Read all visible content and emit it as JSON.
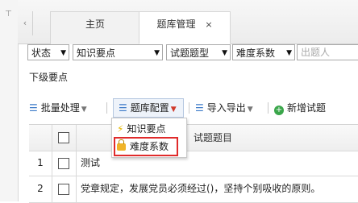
{
  "tabs": [
    {
      "label": "主页"
    },
    {
      "label": "题库管理",
      "close": "×"
    }
  ],
  "tab_prev_arrow": "‹",
  "pin": "⊤",
  "filters": {
    "status": "状态",
    "knowledge_point": "知识要点",
    "question_type": "试题题型",
    "difficulty": "难度系数",
    "author_placeholder": "出题人"
  },
  "subtitle": "下级要点",
  "toolbar": {
    "batch": "批量处理",
    "config": "题库配置",
    "import_export": "导入导出",
    "add": "新增试题"
  },
  "dropdown": {
    "items": [
      "知识要点",
      "难度系数"
    ]
  },
  "table": {
    "header_title": "试题题目",
    "rows": [
      {
        "num": "1",
        "title": "测试"
      },
      {
        "num": "2",
        "title": "党章规定，发展党员必须经过()，坚持个别吸收的原则。"
      }
    ]
  },
  "colors": {
    "highlight_border": "#e02b2b",
    "icon_blue": "#3c7ac8",
    "add_green": "#3aa64a"
  }
}
